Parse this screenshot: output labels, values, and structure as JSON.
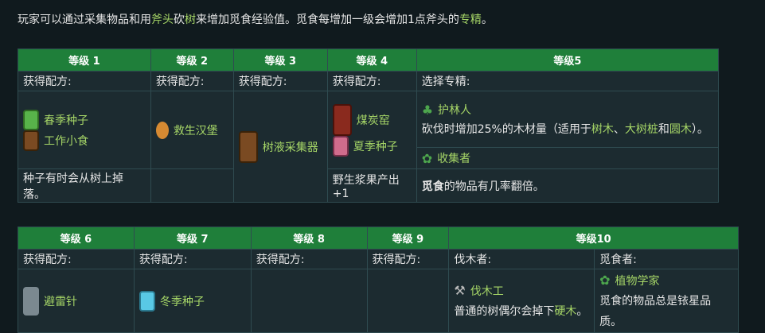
{
  "intro": {
    "part1": "玩家可以通过采集物品和用",
    "link1": "斧头",
    "part2": "砍",
    "link2": "树",
    "part3": "来增加觅食经验值。觅食每增加一级会增加1点斧头的",
    "link3": "专精",
    "part4": "。"
  },
  "table1": {
    "headers": [
      "等级 1",
      "等级 2",
      "等级 3",
      "等级 4",
      "等级5"
    ],
    "row_labels": [
      "获得配方:",
      "获得配方:",
      "获得配方:",
      "获得配方:",
      "选择专精:"
    ],
    "lvl1_items": [
      "春季种子",
      "工作小食"
    ],
    "lvl2_items": [
      "救生汉堡"
    ],
    "lvl3_items": [
      "树液采集器"
    ],
    "lvl4_items": [
      "煤炭窑",
      "夏季种子"
    ],
    "lvl5": {
      "spec1_name": "护林人",
      "spec1_desc_a": "砍伐时增加25%的木材量（适用于",
      "spec1_link_a": "树木",
      "spec1_sep1": "、",
      "spec1_link_b": "大树桩",
      "spec1_sep2": "和",
      "spec1_link_c": "圆木",
      "spec1_end": "）。",
      "spec2_name": "收集者",
      "spec2_desc_bold": "觅食",
      "spec2_desc": "的物品有几率翻倍。"
    },
    "lvl1_note": "种子有时会从树上掉落。",
    "lvl4_note": "野生浆果产出+1"
  },
  "table2": {
    "headers": [
      "等级 6",
      "等级 7",
      "等级 8",
      "等级 9",
      "等级10"
    ],
    "row_labels": [
      "获得配方:",
      "获得配方:",
      "获得配方:",
      "获得配方:",
      "伐木者:",
      "觅食者:"
    ],
    "lvl6_items": [
      "避雷针"
    ],
    "lvl7_items": [
      "冬季种子"
    ],
    "lvl10": {
      "a_name": "伐木工",
      "a_desc": "普通的树偶尔会掉下",
      "a_link": "硬木",
      "a_end": "。",
      "b_name": "植物学家",
      "b_desc": "觅食的物品总是铱星品质。"
    }
  }
}
